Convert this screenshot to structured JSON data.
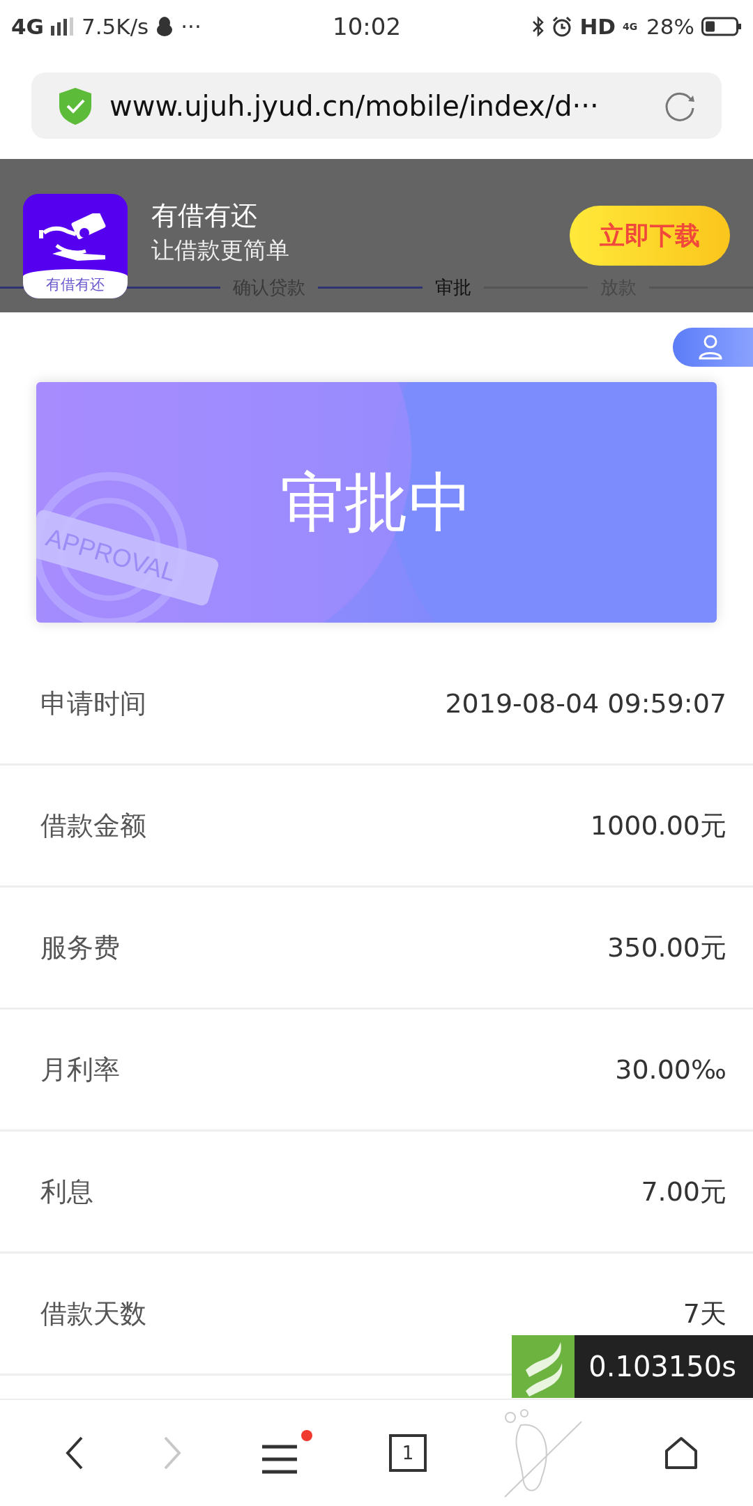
{
  "status_bar": {
    "network": "4G",
    "speed": "7.5K/s",
    "more": "···",
    "time": "10:02",
    "hd": "HD",
    "network_small": "4G",
    "battery": "28%"
  },
  "address_bar": {
    "url": "www.ujuh.jyud.cn/mobile/index/d···"
  },
  "steps": [
    {
      "label": "确认贷款",
      "done": true,
      "selected": false
    },
    {
      "label": "审批",
      "done": true,
      "selected": true
    },
    {
      "label": "放款",
      "done": false,
      "selected": false
    }
  ],
  "app_banner": {
    "icon_caption": "有借有还",
    "name": "有借有还",
    "slogan": "让借款更简单",
    "button": "立即下载"
  },
  "status_card": {
    "title": "审批中",
    "stamp": "APPROVAL"
  },
  "details": [
    {
      "label": "申请时间",
      "value": "2019-08-04 09:59:07"
    },
    {
      "label": "借款金额",
      "value": "1000.00元"
    },
    {
      "label": "服务费",
      "value": "350.00元"
    },
    {
      "label": "月利率",
      "value": "30.00‰"
    },
    {
      "label": "利息",
      "value": "7.00元"
    },
    {
      "label": "借款天数",
      "value": "7天"
    }
  ],
  "timer": "0.103150s",
  "toolbar": {
    "forward_disabled": true,
    "menu_badge": true,
    "tab_count": "1"
  }
}
